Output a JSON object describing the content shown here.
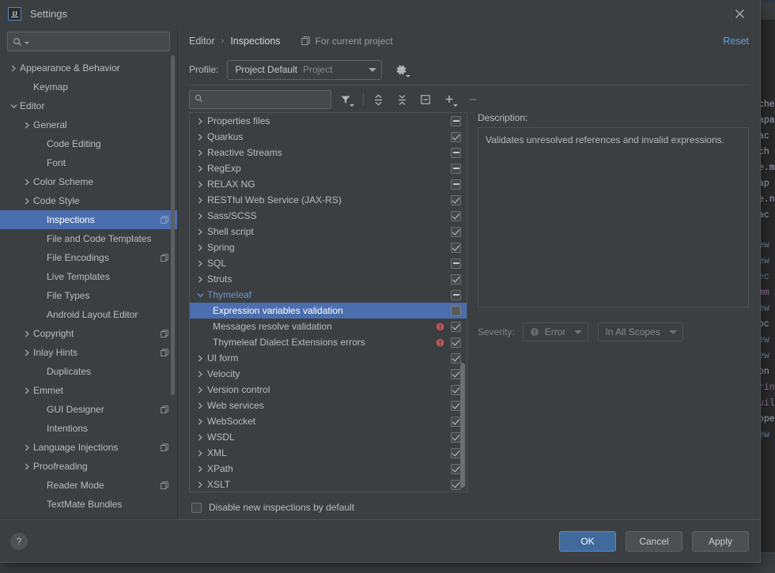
{
  "window": {
    "title": "Settings",
    "logo_text": "IJ",
    "close_icon": "close-icon"
  },
  "sidebar": {
    "search_placeholder": "",
    "search_value": "",
    "items": [
      {
        "label": "Appearance & Behavior",
        "indent": 0,
        "chevron": "right",
        "badge": false
      },
      {
        "label": "Keymap",
        "indent": 1,
        "chevron": "none",
        "badge": false
      },
      {
        "label": "Editor",
        "indent": 0,
        "chevron": "down",
        "badge": false
      },
      {
        "label": "General",
        "indent": 1,
        "chevron": "right",
        "badge": false
      },
      {
        "label": "Code Editing",
        "indent": 2,
        "chevron": "none",
        "badge": false
      },
      {
        "label": "Font",
        "indent": 2,
        "chevron": "none",
        "badge": false
      },
      {
        "label": "Color Scheme",
        "indent": 1,
        "chevron": "right",
        "badge": false
      },
      {
        "label": "Code Style",
        "indent": 1,
        "chevron": "right",
        "badge": false
      },
      {
        "label": "Inspections",
        "indent": 2,
        "chevron": "none",
        "badge": true,
        "selected": true
      },
      {
        "label": "File and Code Templates",
        "indent": 2,
        "chevron": "none",
        "badge": false
      },
      {
        "label": "File Encodings",
        "indent": 2,
        "chevron": "none",
        "badge": true
      },
      {
        "label": "Live Templates",
        "indent": 2,
        "chevron": "none",
        "badge": false
      },
      {
        "label": "File Types",
        "indent": 2,
        "chevron": "none",
        "badge": false
      },
      {
        "label": "Android Layout Editor",
        "indent": 2,
        "chevron": "none",
        "badge": false
      },
      {
        "label": "Copyright",
        "indent": 1,
        "chevron": "right",
        "badge": true
      },
      {
        "label": "Inlay Hints",
        "indent": 1,
        "chevron": "right",
        "badge": true
      },
      {
        "label": "Duplicates",
        "indent": 2,
        "chevron": "none",
        "badge": false
      },
      {
        "label": "Emmet",
        "indent": 1,
        "chevron": "right",
        "badge": false
      },
      {
        "label": "GUI Designer",
        "indent": 2,
        "chevron": "none",
        "badge": true
      },
      {
        "label": "Intentions",
        "indent": 2,
        "chevron": "none",
        "badge": false
      },
      {
        "label": "Language Injections",
        "indent": 1,
        "chevron": "right",
        "badge": true
      },
      {
        "label": "Proofreading",
        "indent": 1,
        "chevron": "right",
        "badge": false
      },
      {
        "label": "Reader Mode",
        "indent": 2,
        "chevron": "none",
        "badge": true
      },
      {
        "label": "TextMate Bundles",
        "indent": 2,
        "chevron": "none",
        "badge": false
      }
    ]
  },
  "main": {
    "breadcrumb": {
      "parent": "Editor",
      "separator": "›",
      "current": "Inspections"
    },
    "for_current_project": "For current project",
    "reset_link": "Reset",
    "profile": {
      "label": "Profile:",
      "name": "Project Default",
      "scope": "Project",
      "gear_icon": "gear-icon"
    },
    "toolbar": {
      "search_value": "",
      "search_placeholder": "",
      "buttons": [
        {
          "name": "filter-icon",
          "enabled": true
        },
        {
          "name": "expand-all-icon",
          "enabled": true
        },
        {
          "name": "collapse-all-icon",
          "enabled": true
        },
        {
          "name": "reset-to-empty-icon",
          "enabled": true
        },
        {
          "name": "add-icon",
          "enabled": true
        },
        {
          "name": "remove-icon",
          "enabled": false
        }
      ]
    },
    "tree": [
      {
        "label": "Properties files",
        "type": "group",
        "state": "indeterminate",
        "expanded": false
      },
      {
        "label": "Quarkus",
        "type": "group",
        "state": "checked",
        "expanded": false
      },
      {
        "label": "Reactive Streams",
        "type": "group",
        "state": "indeterminate",
        "expanded": false
      },
      {
        "label": "RegExp",
        "type": "group",
        "state": "indeterminate",
        "expanded": false
      },
      {
        "label": "RELAX NG",
        "type": "group",
        "state": "indeterminate",
        "expanded": false
      },
      {
        "label": "RESTful Web Service (JAX-RS)",
        "type": "group",
        "state": "checked",
        "expanded": false
      },
      {
        "label": "Sass/SCSS",
        "type": "group",
        "state": "checked",
        "expanded": false
      },
      {
        "label": "Shell script",
        "type": "group",
        "state": "checked",
        "expanded": false
      },
      {
        "label": "Spring",
        "type": "group",
        "state": "checked",
        "expanded": false
      },
      {
        "label": "SQL",
        "type": "group",
        "state": "indeterminate",
        "expanded": false
      },
      {
        "label": "Struts",
        "type": "group",
        "state": "checked",
        "expanded": false
      },
      {
        "label": "Thymeleaf",
        "type": "group",
        "state": "indeterminate",
        "expanded": true
      },
      {
        "label": "Expression variables validation",
        "type": "leaf",
        "state": "unchecked",
        "selected": true,
        "severity": null
      },
      {
        "label": "Messages resolve validation",
        "type": "leaf",
        "state": "checked",
        "severity": "error"
      },
      {
        "label": "Thymeleaf Dialect Extensions errors",
        "type": "leaf",
        "state": "checked",
        "severity": "error"
      },
      {
        "label": "UI form",
        "type": "group",
        "state": "checked",
        "expanded": false
      },
      {
        "label": "Velocity",
        "type": "group",
        "state": "checked",
        "expanded": false
      },
      {
        "label": "Version control",
        "type": "group",
        "state": "checked",
        "expanded": false
      },
      {
        "label": "Web services",
        "type": "group",
        "state": "checked",
        "expanded": false
      },
      {
        "label": "WebSocket",
        "type": "group",
        "state": "checked",
        "expanded": false
      },
      {
        "label": "WSDL",
        "type": "group",
        "state": "checked",
        "expanded": false
      },
      {
        "label": "XML",
        "type": "group",
        "state": "checked",
        "expanded": false
      },
      {
        "label": "XPath",
        "type": "group",
        "state": "checked",
        "expanded": false
      },
      {
        "label": "XSLT",
        "type": "group",
        "state": "checked",
        "expanded": false
      }
    ],
    "disable_new_inspections": {
      "label": "Disable new inspections by default",
      "checked": false
    },
    "description": {
      "label": "Description:",
      "text": "Validates unresolved references and invalid expressions."
    },
    "severity": {
      "label": "Severity:",
      "value": "Error",
      "scope": "In All Scopes",
      "enabled": false
    }
  },
  "footer": {
    "help_label": "?",
    "ok_label": "OK",
    "cancel_label": "Cancel",
    "apply_label": "Apply"
  },
  "background": {
    "tab_text": "t",
    "lines": [
      "che",
      "apa",
      "ac",
      "ch",
      "e.m",
      "ap",
      "e.n",
      "ac",
      "ew",
      "ew",
      "ec",
      "mm",
      "ew",
      "bc",
      "ew",
      "ew",
      "on",
      "rin",
      "uil",
      "ope",
      "ew"
    ]
  },
  "colors": {
    "dialog_bg": "#3c3f41",
    "selection_blue": "#4b6eaf",
    "link_blue": "#5c9fe0",
    "group_label_blue": "#6897d0",
    "error_red": "#c75450",
    "text": "#bbbbbb"
  }
}
